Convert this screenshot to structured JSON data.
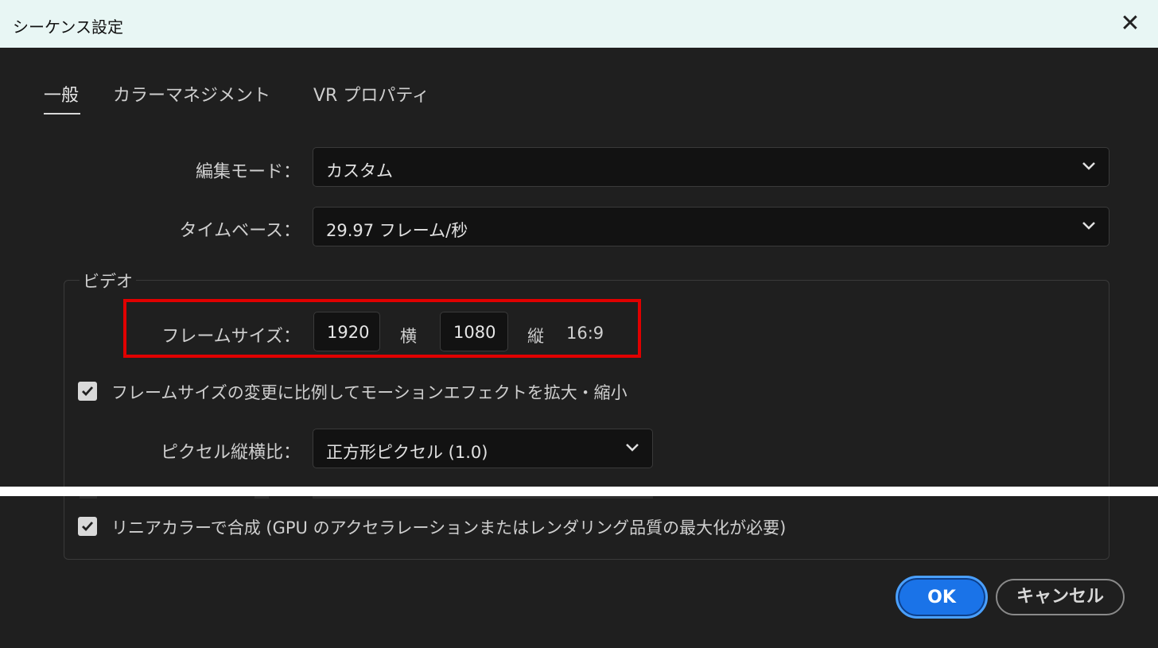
{
  "window": {
    "title": "シーケンス設定",
    "close_label": "✕"
  },
  "tabs": [
    {
      "label": "一般"
    },
    {
      "label": "カラーマネジメント"
    },
    {
      "label": "VR プロパティ"
    }
  ],
  "edit_mode": {
    "label": "編集モード：",
    "value": "カスタム"
  },
  "timebase": {
    "label": "タイムベース：",
    "value": "29.97  フレーム/秒"
  },
  "video_group": {
    "title": "ビデオ",
    "frame_size": {
      "label": "フレームサイズ：",
      "width": "1920",
      "width_unit": "横",
      "height": "1080",
      "height_unit": "縦",
      "aspect": "16:9"
    },
    "scale_checkbox": {
      "label": "フレームサイズの変更に比例してモーションエフェクトを拡大・縮小",
      "checked": true
    },
    "pixel_aspect": {
      "label": "ピクセル縦横比：",
      "value": "正方形ピクセル (1.0)"
    },
    "linear_color_checkbox": {
      "label": "リニアカラーで合成 (GPU のアクセラレーションまたはレンダリング品質の最大化が必要)",
      "checked": true
    }
  },
  "buttons": {
    "ok": "OK",
    "cancel": "キャンセル"
  },
  "colors": {
    "accent": "#1a73e8",
    "highlight_box": "#e00000"
  }
}
